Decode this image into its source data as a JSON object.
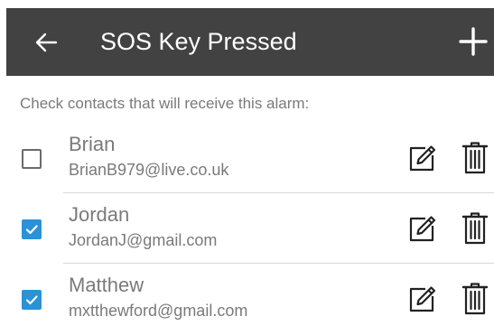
{
  "header": {
    "title": "SOS Key Pressed",
    "background": "#424242",
    "back_icon": "arrow-left-icon",
    "add_icon": "plus-icon"
  },
  "instruction": "Check contacts that will receive this alarm:",
  "accent_color": "#2a92d8",
  "contacts": [
    {
      "name": "Brian",
      "email": "BrianB979@live.co.uk",
      "checked": false
    },
    {
      "name": "Jordan",
      "email": "JordanJ@gmail.com",
      "checked": true
    },
    {
      "name": "Matthew",
      "email": "mxtthewford@gmail.com",
      "checked": true
    }
  ],
  "row_icons": {
    "edit": "edit-pencil-icon",
    "delete": "trash-icon"
  }
}
